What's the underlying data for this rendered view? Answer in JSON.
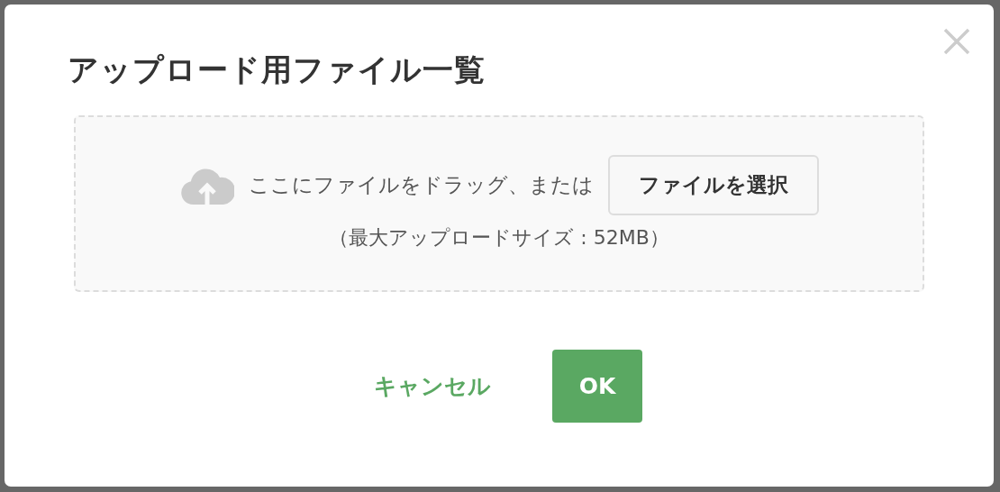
{
  "dialog": {
    "title": "アップロード用ファイル一覧",
    "dropzone": {
      "drag_text": "ここにファイルをドラッグ、または",
      "select_button": "ファイルを選択",
      "max_size_text": "（最大アップロードサイズ : 52MB）"
    },
    "buttons": [
      {
        "label": "キャンセル",
        "kind": "link"
      },
      {
        "label": "OK",
        "kind": "primary"
      }
    ]
  }
}
